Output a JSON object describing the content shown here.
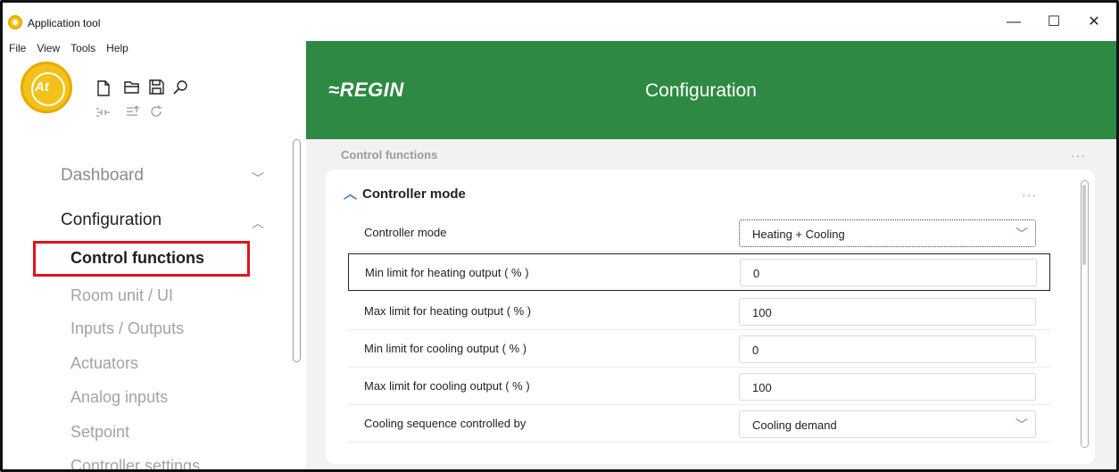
{
  "window": {
    "title": "Application tool",
    "controls": {
      "minimize": "—",
      "maximize": "☐",
      "close": "✕"
    }
  },
  "menu": [
    "File",
    "View",
    "Tools",
    "Help"
  ],
  "toolbar": {
    "logo_text": "At",
    "icons_primary": [
      "new-file-icon",
      "open-folder-icon",
      "save-icon",
      "search-icon"
    ],
    "icons_secondary": [
      "connect-icon",
      "upload-icon",
      "refresh-icon"
    ]
  },
  "sidebar": {
    "items": [
      {
        "label": "Dashboard",
        "chevron": "﹀",
        "expanded": false
      },
      {
        "label": "Configuration",
        "chevron": "︿",
        "expanded": true
      }
    ],
    "subitems": [
      "Control functions",
      "Room unit / UI",
      "Inputs / Outputs",
      "Actuators",
      "Analog inputs",
      "Setpoint",
      "Controller settings"
    ],
    "active_subitem": "Control functions"
  },
  "header": {
    "brand": "≈REGIN",
    "title": "Configuration",
    "bg_color": "#2e8a42"
  },
  "content": {
    "section_label": "Control functions",
    "more_dots": "···",
    "card": {
      "title": "Controller mode",
      "collapse_chevron": "︿",
      "more_dots": "···",
      "rows": [
        {
          "label": "Controller mode",
          "value": "Heating + Cooling",
          "type": "dropdown"
        },
        {
          "label": "Min limit for heating output ( % )",
          "value": "0",
          "type": "input"
        },
        {
          "label": "Max limit for heating output ( % )",
          "value": "100",
          "type": "input"
        },
        {
          "label": "Min limit for cooling output ( % )",
          "value": "0",
          "type": "input"
        },
        {
          "label": "Max limit for cooling output ( % )",
          "value": "100",
          "type": "input"
        },
        {
          "label": "Cooling sequence controlled by",
          "value": "Cooling demand",
          "type": "dropdown"
        }
      ]
    }
  },
  "colors": {
    "highlight": "#e2141b",
    "accent": "#4a7ec5"
  }
}
